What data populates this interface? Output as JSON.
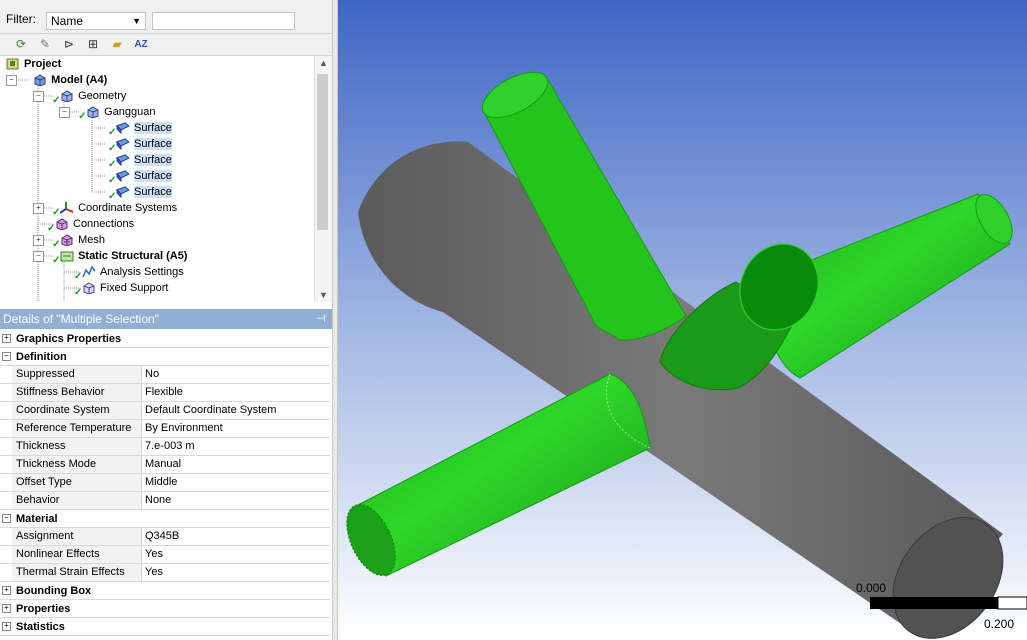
{
  "filter": {
    "label": "Filter:",
    "selected": "Name",
    "search_value": ""
  },
  "toolbar": {
    "icons": [
      "refresh-icon",
      "pencil-eraser-icon",
      "expand-icon",
      "plus-box-icon",
      "folder-icon",
      "sort-az-icon"
    ]
  },
  "tree": {
    "rows": [
      {
        "label": "Project",
        "bold": true
      },
      {
        "label": "Model (A4)",
        "bold": true
      },
      {
        "label": "Geometry"
      },
      {
        "label": "Gangguan"
      },
      {
        "label": "Surface"
      },
      {
        "label": "Surface"
      },
      {
        "label": "Surface"
      },
      {
        "label": "Surface"
      },
      {
        "label": "Surface"
      },
      {
        "label": "Coordinate Systems"
      },
      {
        "label": "Connections"
      },
      {
        "label": "Mesh"
      },
      {
        "label": "Static Structural (A5)",
        "bold": true
      },
      {
        "label": "Analysis Settings"
      },
      {
        "label": "Fixed Support"
      }
    ]
  },
  "details": {
    "title": "Details of \"Multiple Selection\"",
    "pin": "⊣",
    "categories": {
      "graphics": "Graphics Properties",
      "definition": "Definition",
      "material": "Material",
      "bounding_box": "Bounding Box",
      "properties": "Properties",
      "statistics": "Statistics"
    },
    "definition": [
      {
        "name": "Suppressed",
        "value": "No"
      },
      {
        "name": "Stiffness Behavior",
        "value": "Flexible"
      },
      {
        "name": "Coordinate System",
        "value": "Default Coordinate System"
      },
      {
        "name": "Reference Temperature",
        "value": "By Environment"
      },
      {
        "name": "Thickness",
        "value": "7.e-003 m"
      },
      {
        "name": "Thickness Mode",
        "value": "Manual"
      },
      {
        "name": "Offset Type",
        "value": "Middle"
      },
      {
        "name": "Behavior",
        "value": "None"
      }
    ],
    "material": [
      {
        "name": "Assignment",
        "value": "Q345B"
      },
      {
        "name": "Nonlinear Effects",
        "value": "Yes"
      },
      {
        "name": "Thermal Strain Effects",
        "value": "Yes"
      }
    ]
  },
  "viewport": {
    "scale_left": "0.000",
    "scale_right": "0.200",
    "colors": {
      "pipe_green": "#22c41b",
      "chord_gray": "#6e6e6e",
      "bg_top": "#3e66c4",
      "bg_bottom": "#ffffff"
    }
  }
}
